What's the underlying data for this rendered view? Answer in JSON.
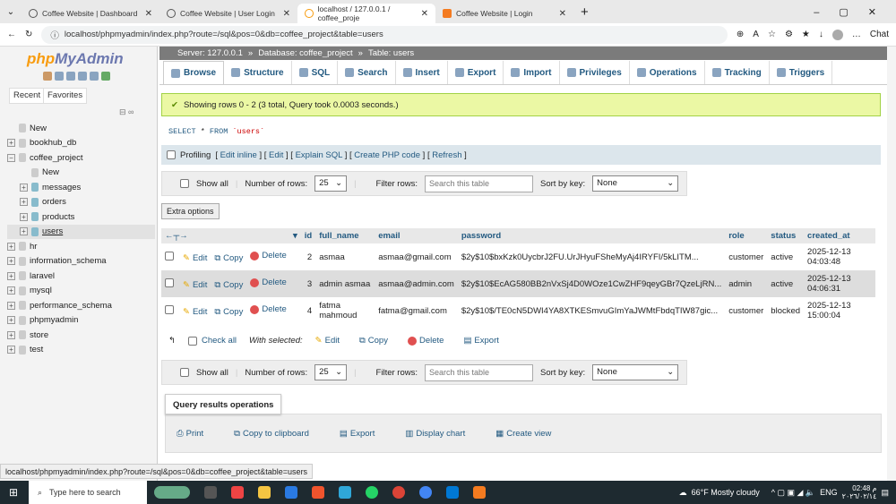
{
  "browser": {
    "tabs": [
      {
        "label": "Coffee Website | Dashboard"
      },
      {
        "label": "Coffee Website | User Login"
      },
      {
        "label": "localhost / 127.0.0.1 / coffee_proje"
      },
      {
        "label": "Coffee Website | Login"
      }
    ],
    "url": "localhost/phpmyadmin/index.php?route=/sql&pos=0&db=coffee_project&table=users",
    "chat": "Chat"
  },
  "sidebar": {
    "logo_php": "php",
    "logo_my": "MyAdmin",
    "recent": "Recent",
    "favorites": "Favorites",
    "tree": [
      {
        "label": "New",
        "lvl": 0
      },
      {
        "label": "bookhub_db",
        "lvl": 0
      },
      {
        "label": "coffee_project",
        "lvl": 0
      },
      {
        "label": "New",
        "lvl": 1
      },
      {
        "label": "messages",
        "lvl": 1
      },
      {
        "label": "orders",
        "lvl": 1
      },
      {
        "label": "products",
        "lvl": 1
      },
      {
        "label": "users",
        "lvl": 1
      },
      {
        "label": "hr",
        "lvl": 0
      },
      {
        "label": "information_schema",
        "lvl": 0
      },
      {
        "label": "laravel",
        "lvl": 0
      },
      {
        "label": "mysql",
        "lvl": 0
      },
      {
        "label": "performance_schema",
        "lvl": 0
      },
      {
        "label": "phpmyadmin",
        "lvl": 0
      },
      {
        "label": "store",
        "lvl": 0
      },
      {
        "label": "test",
        "lvl": 0
      }
    ]
  },
  "breadcrumb": {
    "server": "Server: 127.0.0.1",
    "database": "Database: coffee_project",
    "table": "Table: users"
  },
  "tabs": [
    "Browse",
    "Structure",
    "SQL",
    "Search",
    "Insert",
    "Export",
    "Import",
    "Privileges",
    "Operations",
    "Tracking",
    "Triggers"
  ],
  "message": "Showing rows 0 - 2 (3 total, Query took 0.0003 seconds.)",
  "sql": {
    "kw1": "SELECT",
    "star": " * ",
    "kw2": "FROM",
    "table": " `users`"
  },
  "profiling": {
    "label": "Profiling",
    "links": [
      "Edit inline",
      "Edit",
      "Explain SQL",
      "Create PHP code",
      "Refresh"
    ]
  },
  "filter": {
    "show_all": "Show all",
    "rows_label": "Number of rows:",
    "rows_value": "25",
    "filter_label": "Filter rows:",
    "placeholder": "Search this table",
    "sort_label": "Sort by key:",
    "sort_value": "None"
  },
  "extra_options": "Extra options",
  "table": {
    "columns": [
      "id",
      "full_name",
      "email",
      "password",
      "role",
      "status",
      "created_at"
    ],
    "actions": {
      "edit": "Edit",
      "copy": "Copy",
      "delete": "Delete"
    },
    "rows": [
      {
        "id": "2",
        "full_name": "asmaa",
        "email": "asmaa@gmail.com",
        "password": "$2y$10$bxKzk0UycbrJ2FU.UrJHyuFSheMyAj4IRYFI/5kLITM...",
        "role": "customer",
        "status": "active",
        "created_at": "2025-12-13 04:03:48"
      },
      {
        "id": "3",
        "full_name": "admin asmaa",
        "email": "asmaa@admin.com",
        "password": "$2y$10$EcAG580BB2nVxSj4D0WOze1CwZHF9qeyGBr7QzeLjRN...",
        "role": "admin",
        "status": "active",
        "created_at": "2025-12-13 04:06:31"
      },
      {
        "id": "4",
        "full_name": "fatma mahmoud",
        "email": "fatma@gmail.com",
        "password": "$2y$10$/TE0cN5DWI4YA8XTKESmvuGImYaJWMtFbdqTIW87gic...",
        "role": "customer",
        "status": "blocked",
        "created_at": "2025-12-13 15:00:04"
      }
    ]
  },
  "with_selected": {
    "check_all": "Check all",
    "label": "With selected:",
    "edit": "Edit",
    "copy": "Copy",
    "delete": "Delete",
    "export": "Export"
  },
  "query_ops": {
    "title": "Query results operations",
    "items": [
      "Print",
      "Copy to clipboard",
      "Export",
      "Display chart",
      "Create view"
    ]
  },
  "status_url": "localhost/phpmyadmin/index.php?route=/sql&pos=0&db=coffee_project&table=users",
  "taskbar": {
    "search": "Type here to search",
    "weather": "66°F  Mostly cloudy",
    "lang": "ENG",
    "time": "02:48 م",
    "date": "٢٠٢٦/٠٢/١٤"
  }
}
